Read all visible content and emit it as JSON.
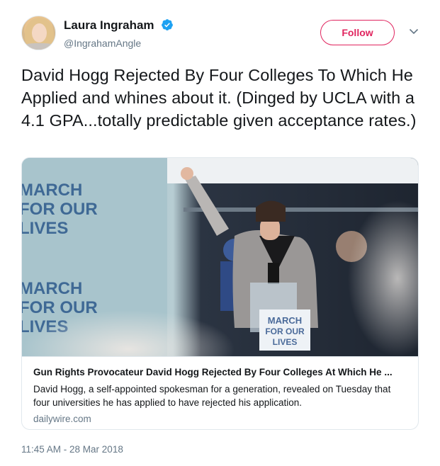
{
  "author": {
    "name": "Laura Ingraham",
    "handle": "@IngrahamAngle",
    "verified": true
  },
  "actions": {
    "follow_label": "Follow"
  },
  "tweet": {
    "text": "David Hogg Rejected By Four Colleges To Which He Applied and whines about it. (Dinged by UCLA with a 4.1 GPA...totally predictable given acceptance rates.)",
    "timestamp": "11:45 AM - 28 Mar 2018"
  },
  "card": {
    "title": "Gun Rights Provocateur David Hogg Rejected By Four Colleges At Which He ...",
    "description": "David Hogg, a self-appointed spokesman for a generation, revealed on Tuesday that four universities he has applied to have rejected his application.",
    "domain": "dailywire.com",
    "banner_lines": [
      "MARCH",
      "FOR OUR",
      "LIVES"
    ]
  },
  "colors": {
    "accent": "#e0245e",
    "verified": "#1da1f2",
    "muted_text": "#657786"
  }
}
